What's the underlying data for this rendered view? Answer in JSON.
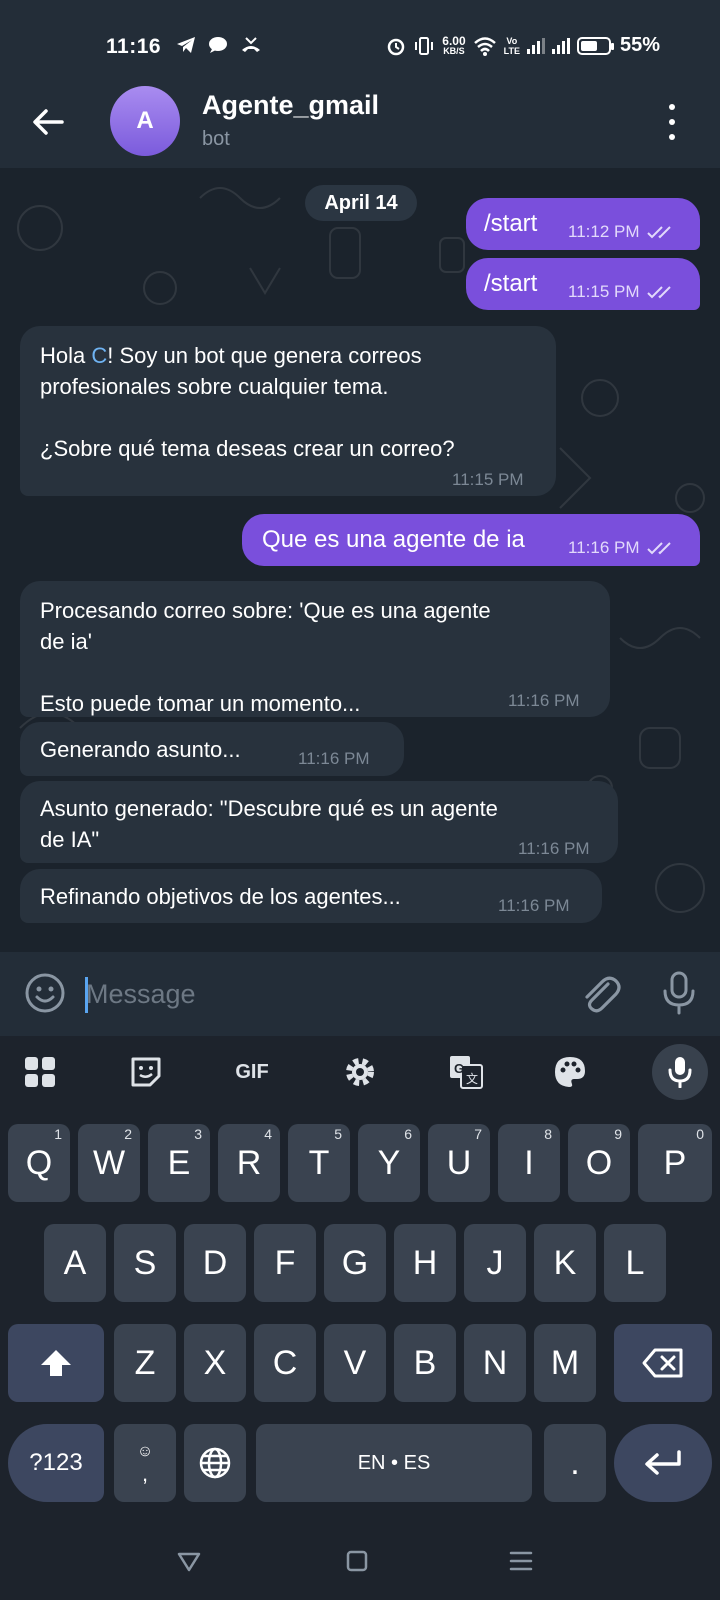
{
  "status_bar": {
    "time": "11:16",
    "speed": "6.00",
    "speed_unit": "KB/S",
    "battery": "55%",
    "icons": [
      "telegram-icon",
      "chat-icon",
      "missed-call-icon",
      "alarm-icon",
      "vibrate-icon",
      "wifi-icon",
      "volte-icon",
      "signal-icon",
      "signal-icon",
      "battery-icon"
    ]
  },
  "header": {
    "avatar_letter": "A",
    "title": "Agente_gmail",
    "subtitle": "bot"
  },
  "chat": {
    "date": "April 14",
    "messages": [
      {
        "dir": "out",
        "text": "/start",
        "time": "11:12 PM"
      },
      {
        "dir": "out",
        "text": "/start",
        "time": "11:15 PM"
      },
      {
        "dir": "in",
        "line1_a": "Hola ",
        "line1_hl": "C",
        "line1_b": "! Soy un bot que genera correos",
        "line2": "profesionales sobre cualquier tema.",
        "line3": "¿Sobre qué tema deseas crear un correo?",
        "time": "11:15 PM"
      },
      {
        "dir": "out",
        "text": "Que es una agente de ia",
        "time": "11:16 PM"
      },
      {
        "dir": "in",
        "line1": "Procesando correo sobre: 'Que es una agente",
        "line2": "de ia'",
        "line3": "Esto puede tomar un momento...",
        "time": "11:16 PM"
      },
      {
        "dir": "in",
        "text": "Generando asunto...",
        "time": "11:16 PM"
      },
      {
        "dir": "in",
        "line1": "Asunto generado: \"Descubre qué es un agente",
        "line2": "de IA\"",
        "time": "11:16 PM"
      },
      {
        "dir": "in",
        "text": "Refinando objetivos de los agentes...",
        "time": "11:16 PM"
      }
    ]
  },
  "input": {
    "placeholder": "Message"
  },
  "keyboard": {
    "toolbar": {
      "gif": "GIF"
    },
    "row1": [
      {
        "k": "Q",
        "n": "1"
      },
      {
        "k": "W",
        "n": "2"
      },
      {
        "k": "E",
        "n": "3"
      },
      {
        "k": "R",
        "n": "4"
      },
      {
        "k": "T",
        "n": "5"
      },
      {
        "k": "Y",
        "n": "6"
      },
      {
        "k": "U",
        "n": "7"
      },
      {
        "k": "I",
        "n": "8"
      },
      {
        "k": "O",
        "n": "9"
      },
      {
        "k": "P",
        "n": "0"
      }
    ],
    "row2": [
      "A",
      "S",
      "D",
      "F",
      "G",
      "H",
      "J",
      "K",
      "L"
    ],
    "row3": [
      "Z",
      "X",
      "C",
      "V",
      "B",
      "N",
      "M"
    ],
    "symbols": "?123",
    "comma": ",",
    "space": "EN • ES",
    "period": "."
  }
}
